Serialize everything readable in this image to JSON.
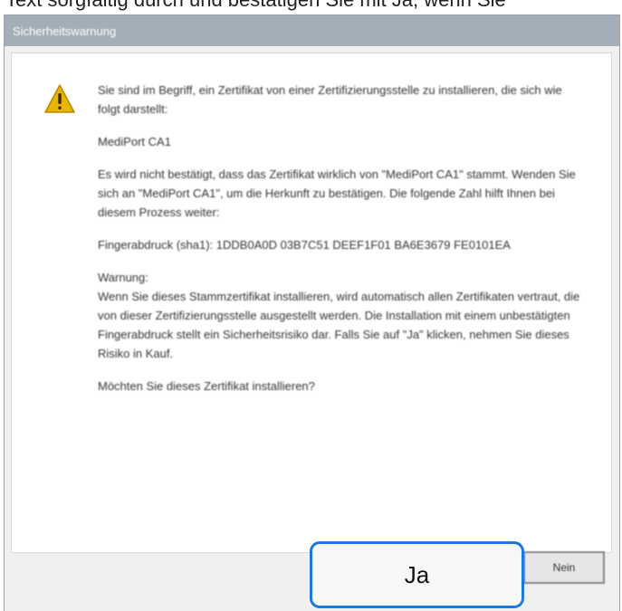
{
  "instruction": "Text sorgfältig durch und bestätigen Sie mit Ja, wenn Sie",
  "dialog": {
    "title": "Sicherheitswarnung",
    "icon": "warning-icon",
    "paragraphs": [
      "Sie sind im Begriff, ein Zertifikat von einer Zertifizierungsstelle zu installieren, die sich wie folgt darstellt:",
      "MediPort CA1",
      "Es wird nicht bestätigt, dass das Zertifikat wirklich von \"MediPort CA1\" stammt. Wenden Sie sich an \"MediPort CA1\", um die Herkunft zu bestätigen. Die folgende Zahl hilft Ihnen bei diesem Prozess weiter:",
      "Fingerabdruck (sha1): 1DDB0A0D 03B7C51 DEEF1F01 BA6E3679 FE0101EA",
      "Warnung:\nWenn Sie dieses Stammzertifikat installieren, wird automatisch allen Zertifikaten vertraut, die von dieser Zertifizierungsstelle ausgestellt werden. Die Installation mit einem unbestätigten Fingerabdruck stellt ein Sicherheitsrisiko dar. Falls Sie auf \"Ja\" klicken, nehmen Sie dieses Risiko in Kauf.",
      "Möchten Sie dieses Zertifikat installieren?"
    ],
    "buttons": {
      "yes_label": "Ja",
      "no_label": "Nein"
    }
  },
  "colors": {
    "titlebar": "#a3aeb9",
    "highlight": "#1d7adc",
    "warning": "#e8b400"
  }
}
